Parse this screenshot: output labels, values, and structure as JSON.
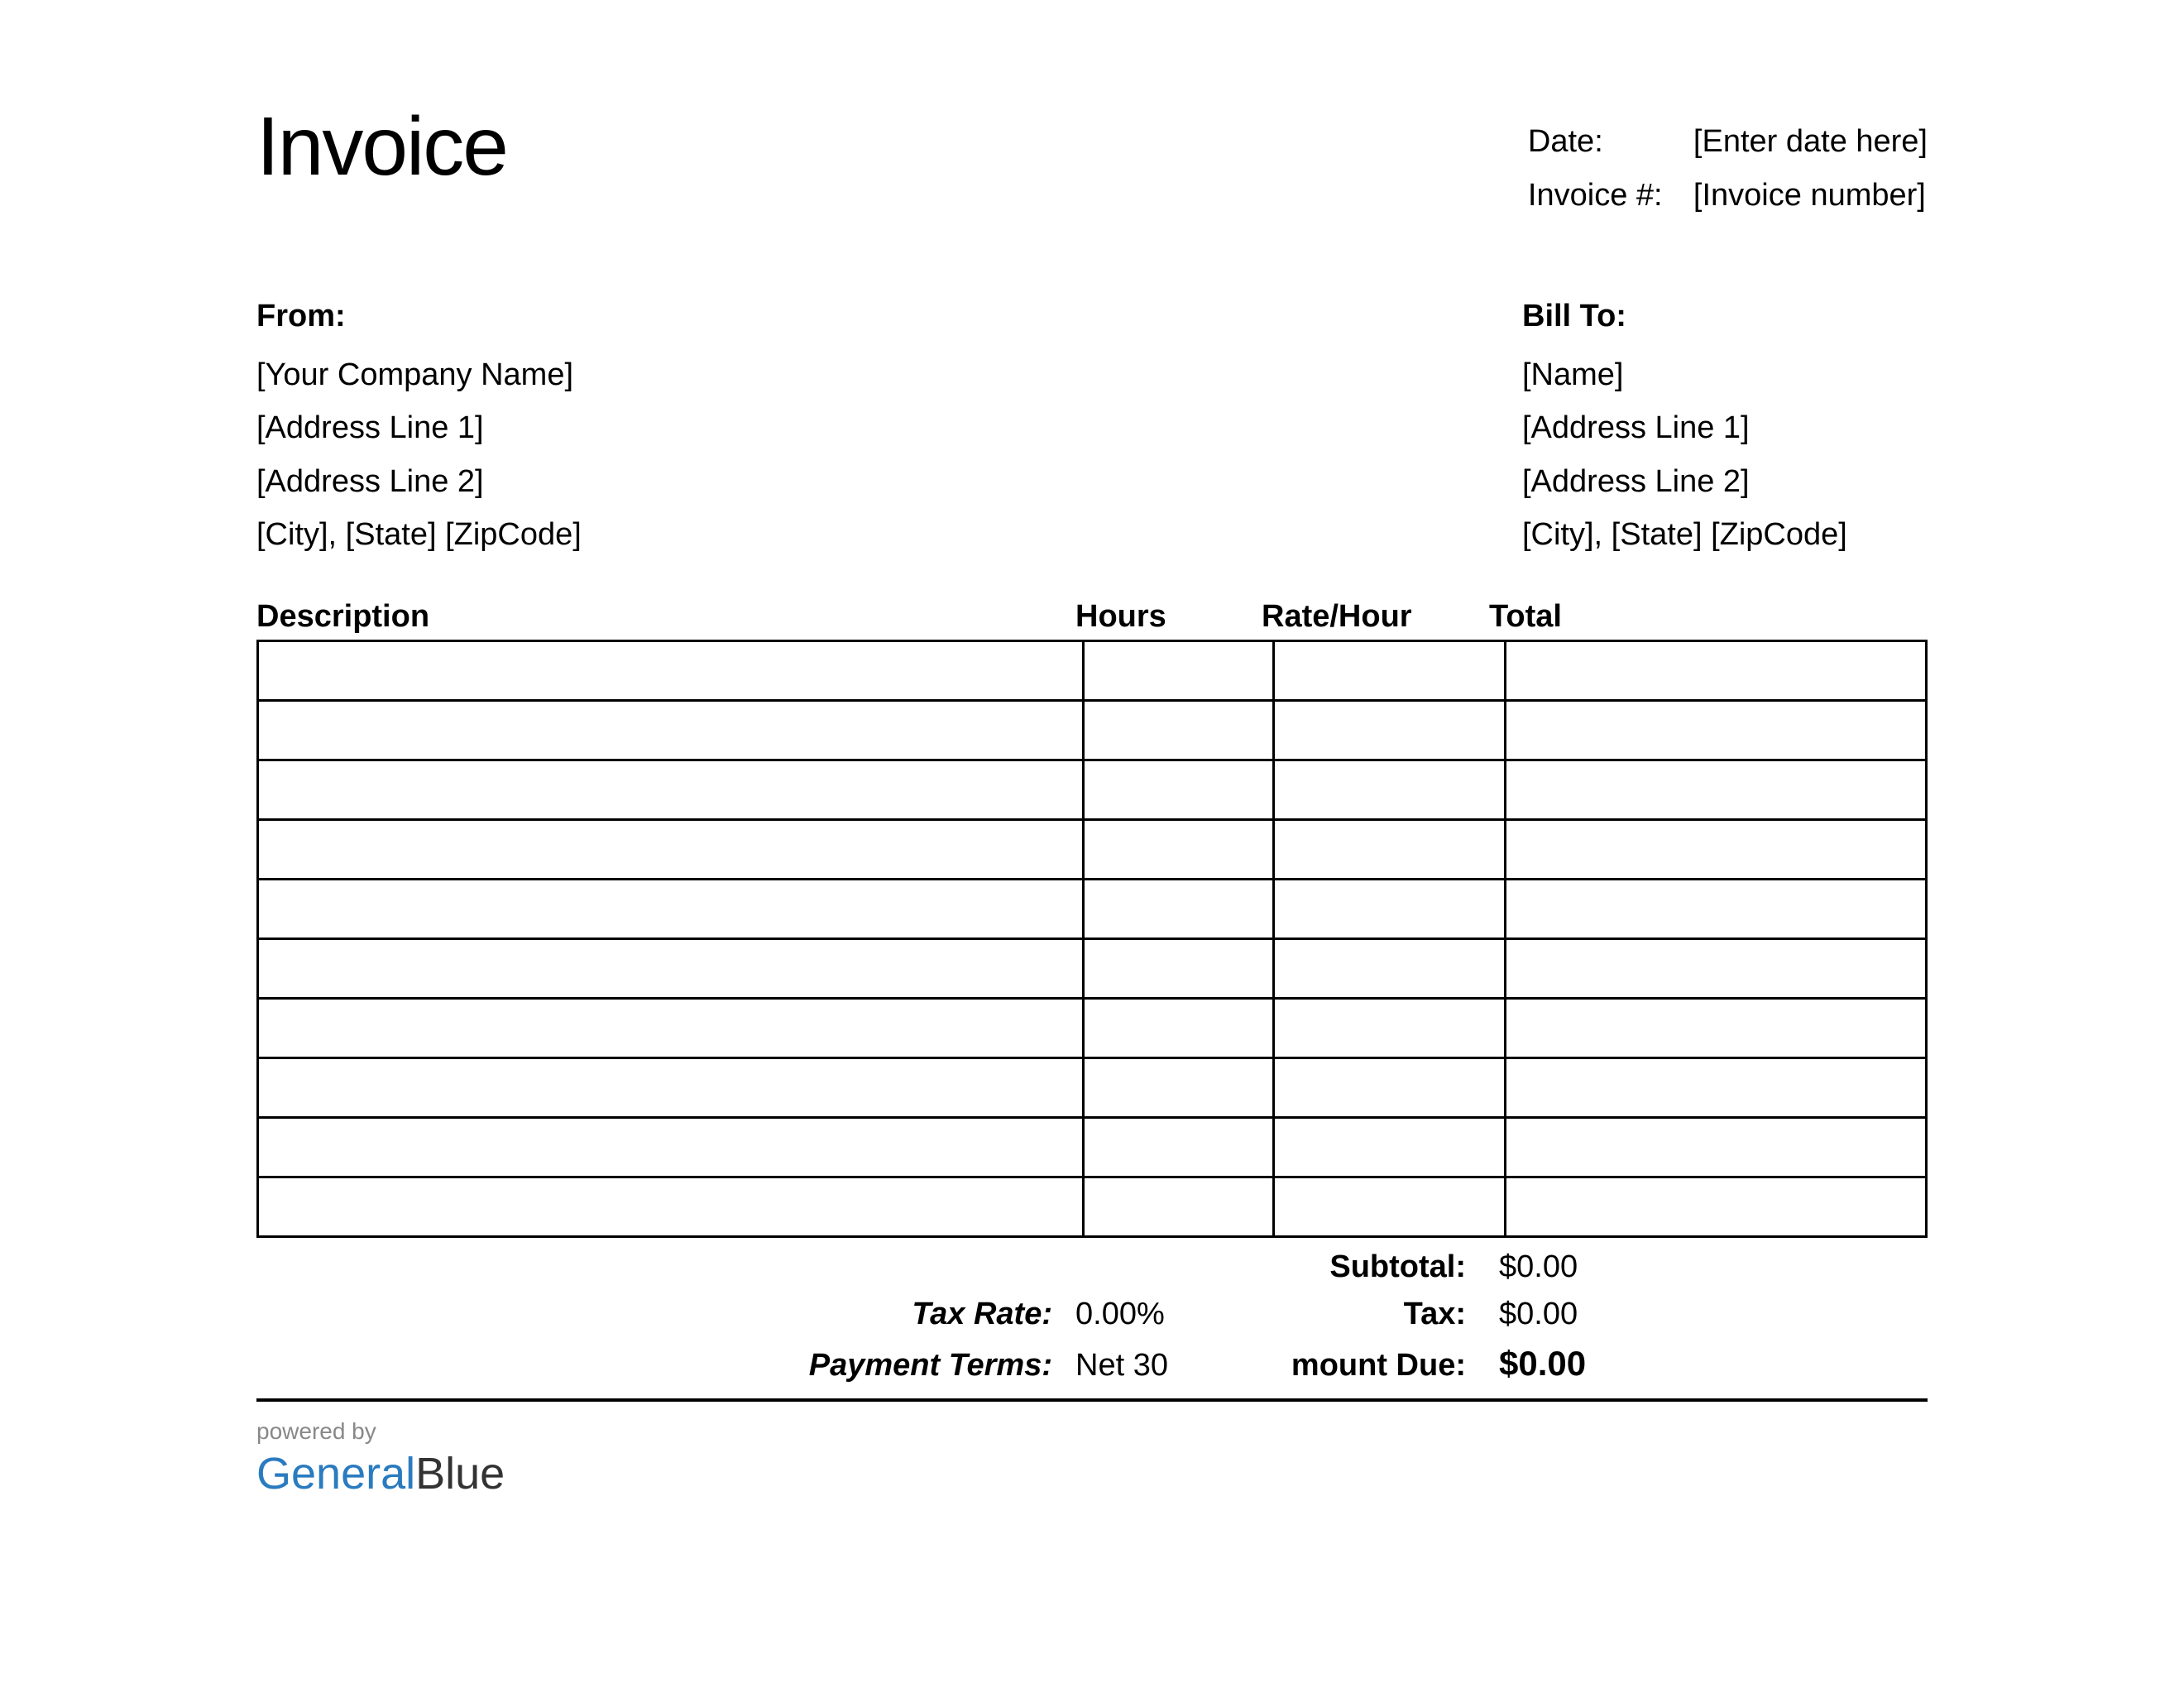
{
  "title": "Invoice",
  "meta": {
    "date_label": "Date:",
    "date_value": "[Enter date here]",
    "invoice_num_label": "Invoice #:",
    "invoice_num_value": "[Invoice number]"
  },
  "from": {
    "heading": "From:",
    "company": "[Your Company Name]",
    "addr1": "[Address Line 1]",
    "addr2": "[Address Line 2]",
    "city_state_zip": "[City], [State] [ZipCode]"
  },
  "bill_to": {
    "heading": "Bill To:",
    "name": "[Name]",
    "addr1": "[Address Line 1]",
    "addr2": "[Address Line 2]",
    "city_state_zip": "[City], [State] [ZipCode]"
  },
  "columns": {
    "description": "Description",
    "hours": "Hours",
    "rate": "Rate/Hour",
    "total": "Total"
  },
  "rows": [
    {
      "description": "",
      "hours": "",
      "rate": "",
      "total": ""
    },
    {
      "description": "",
      "hours": "",
      "rate": "",
      "total": ""
    },
    {
      "description": "",
      "hours": "",
      "rate": "",
      "total": ""
    },
    {
      "description": "",
      "hours": "",
      "rate": "",
      "total": ""
    },
    {
      "description": "",
      "hours": "",
      "rate": "",
      "total": ""
    },
    {
      "description": "",
      "hours": "",
      "rate": "",
      "total": ""
    },
    {
      "description": "",
      "hours": "",
      "rate": "",
      "total": ""
    },
    {
      "description": "",
      "hours": "",
      "rate": "",
      "total": ""
    },
    {
      "description": "",
      "hours": "",
      "rate": "",
      "total": ""
    },
    {
      "description": "",
      "hours": "",
      "rate": "",
      "total": ""
    }
  ],
  "summary": {
    "subtotal_label": "Subtotal:",
    "subtotal_value": "$0.00",
    "tax_rate_label": "Tax Rate:",
    "tax_rate_value": "0.00%",
    "tax_label": "Tax:",
    "tax_value": "$0.00",
    "payment_terms_label": "Payment Terms:",
    "payment_terms_value": "Net 30",
    "amount_due_label": "mount Due:",
    "amount_due_value": "$0.00"
  },
  "footer": {
    "powered_by": "powered by",
    "brand_general": "General",
    "brand_blue": "Blue"
  }
}
